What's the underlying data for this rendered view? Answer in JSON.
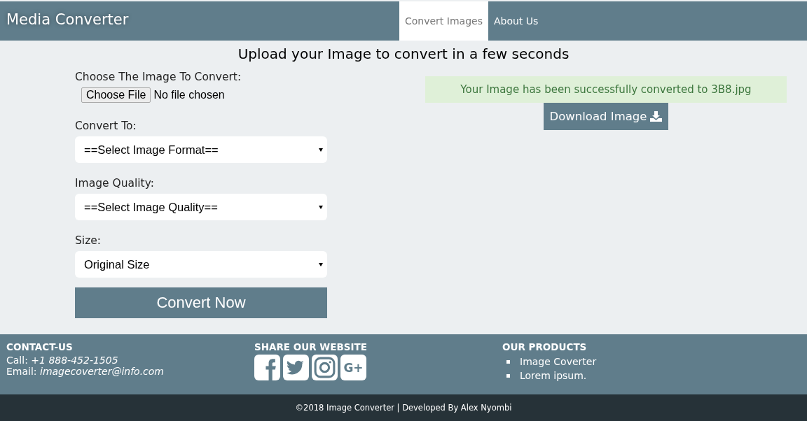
{
  "brand": "Media Converter",
  "nav": [
    {
      "label": "Convert Images",
      "selected": true
    },
    {
      "label": "About Us",
      "selected": false
    }
  ],
  "heading": "Upload your Image to convert in a few seconds",
  "form": {
    "file_label": "Choose The Image To Convert:",
    "file_button": "Choose File",
    "file_status": "No file chosen",
    "selects": [
      {
        "label": "Convert To:",
        "value": "==Select Image Format=="
      },
      {
        "label": "Image Quality:",
        "value": "==Select Image Quality=="
      },
      {
        "label": "Size:",
        "value": "Original Size"
      }
    ],
    "submit": "Convert Now"
  },
  "alert": "Your Image has been successfully converted to 3B8.jpg",
  "download_button": "Download Image",
  "footer": {
    "contact": {
      "title": "CONTACT-US",
      "lines": [
        "Call: *+1 888-452-1505*",
        "Email: *imagecoverter@info.com*"
      ]
    },
    "share": {
      "title": "SHARE OUR WEBSITE",
      "buttons": [
        {
          "kind": "facebook"
        },
        {
          "kind": "twitter"
        },
        {
          "kind": "instagram"
        },
        {
          "kind": "text",
          "text": "G+"
        }
      ]
    },
    "products": {
      "title": "OUR PRODUCTS",
      "items": [
        "Image Coverter",
        "Lorem ipsum."
      ]
    }
  },
  "copyright": "©2018 Image Converter | Developed By Alex Nyombi"
}
